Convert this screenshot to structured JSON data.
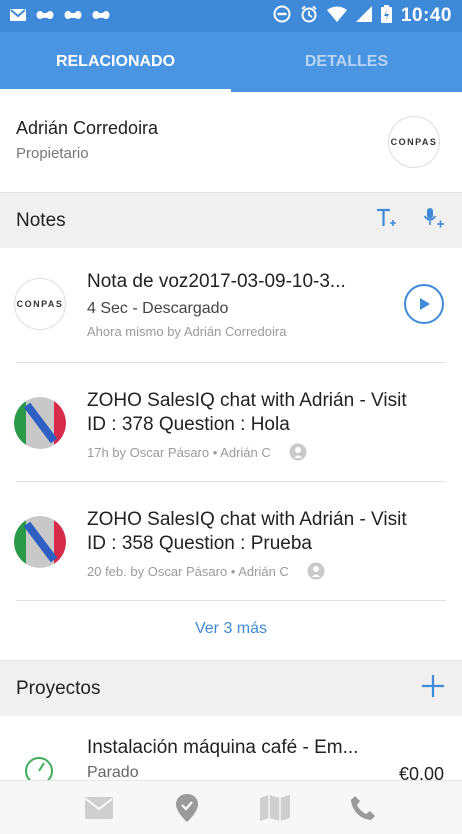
{
  "status_bar": {
    "time": "10:40",
    "icons": [
      "gmail-icon",
      "pets-icon",
      "pets-icon",
      "pets-icon",
      "dnd-icon",
      "alarm-icon",
      "wifi-icon",
      "signal-icon",
      "battery-icon"
    ]
  },
  "tabs": [
    {
      "label": "RELACIONADO",
      "active": true
    },
    {
      "label": "DETALLES",
      "active": false
    }
  ],
  "owner": {
    "name": "Adrián Corredoira",
    "role": "Propietario",
    "logo_text": "CONPAS"
  },
  "notes_section": {
    "title": "Notes",
    "icons": [
      "add-text-note-icon",
      "add-voice-note-icon"
    ]
  },
  "notes": [
    {
      "avatar_text": "CONPAS",
      "title": "Nota de voz2017-03-09-10-3...",
      "subtitle": "4 Sec  -  Descargado",
      "meta": "Ahora mismo by Adrián Corredoira"
    },
    {
      "title_line1": "ZOHO SalesIQ chat with Adrián - Visit",
      "title_line2": "ID : 378  Question : Hola",
      "meta": "17h by Oscar Pásaro • Adrián C"
    },
    {
      "title_line1": "ZOHO SalesIQ chat with Adrián - Visit",
      "title_line2": "ID : 358  Question : Prueba",
      "meta": "20 feb. by Oscar Pásaro • Adrián C"
    }
  ],
  "more_link": "Ver 3 más",
  "projects_section": {
    "title": "Proyectos"
  },
  "project": {
    "title": "Instalación máquina café - Em...",
    "status": "Parado",
    "amount": "€0,00"
  },
  "bottom_nav": [
    "mail-icon",
    "location-icon",
    "map-icon",
    "phone-icon"
  ],
  "colors": {
    "primary": "#4a95e2",
    "status_bar": "#3f8ad8",
    "accent": "#3f8ad8"
  }
}
